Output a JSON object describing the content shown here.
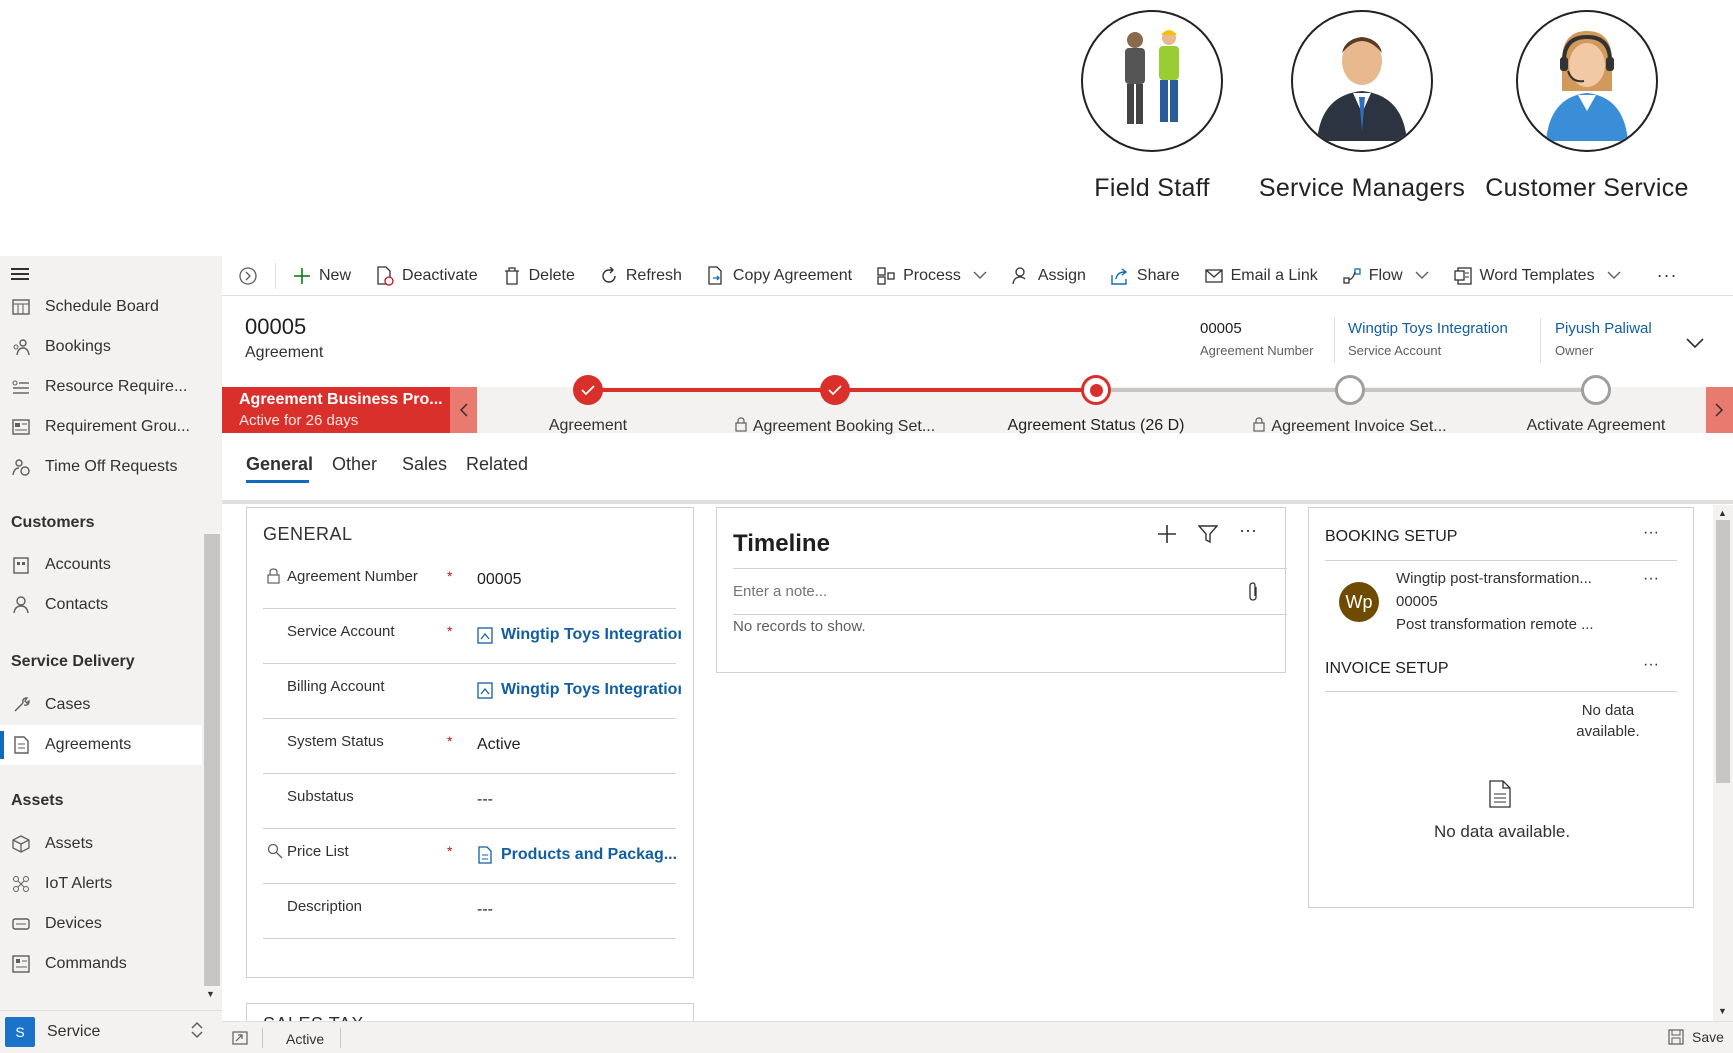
{
  "personas": [
    {
      "label": "Field Staff"
    },
    {
      "label": "Service Managers"
    },
    {
      "label": "Customer Service"
    }
  ],
  "sidebar": {
    "items_top": [
      {
        "label": "Schedule Board",
        "icon": "calendar-grid-icon"
      },
      {
        "label": "Bookings",
        "icon": "people-icon"
      },
      {
        "label": "Resource Require...",
        "icon": "list-icon"
      },
      {
        "label": "Requirement Grou...",
        "icon": "group-list-icon"
      },
      {
        "label": "Time Off Requests",
        "icon": "person-clock-icon"
      }
    ],
    "groups": [
      {
        "title": "Customers",
        "items": [
          {
            "label": "Accounts"
          },
          {
            "label": "Contacts"
          }
        ]
      },
      {
        "title": "Service Delivery",
        "items": [
          {
            "label": "Cases"
          },
          {
            "label": "Agreements"
          }
        ]
      },
      {
        "title": "Assets",
        "items": [
          {
            "label": "Assets"
          },
          {
            "label": "IoT Alerts"
          },
          {
            "label": "Devices"
          },
          {
            "label": "Commands"
          }
        ]
      }
    ],
    "area": {
      "badge": "S",
      "label": "Service"
    }
  },
  "commands": {
    "new": "New",
    "deactivate": "Deactivate",
    "delete": "Delete",
    "refresh": "Refresh",
    "copy": "Copy Agreement",
    "process": "Process",
    "assign": "Assign",
    "share": "Share",
    "email": "Email a Link",
    "flow": "Flow",
    "word": "Word Templates",
    "more": "···"
  },
  "header": {
    "title": "00005",
    "entity": "Agreement",
    "fields": [
      {
        "value": "00005",
        "label": "Agreement Number"
      },
      {
        "value": "Wingtip Toys Integration",
        "label": "Service Account"
      },
      {
        "value": "Piyush Paliwal",
        "label": "Owner"
      }
    ]
  },
  "bpf": {
    "active_title": "Agreement Business Pro...",
    "active_sub": "Active for 26 days",
    "stages": [
      {
        "label": "Agreement",
        "state": "done"
      },
      {
        "label": "Agreement Booking Set...",
        "state": "done"
      },
      {
        "label": "Agreement Status  (26 D)",
        "state": "active"
      },
      {
        "label": "Agreement Invoice Set...",
        "state": "pending"
      },
      {
        "label": "Activate Agreement",
        "state": "pending"
      }
    ]
  },
  "tabs": [
    "General",
    "Other",
    "Sales",
    "Related"
  ],
  "general": {
    "heading": "GENERAL",
    "fields": [
      {
        "label": "Agreement Number",
        "value": "00005"
      },
      {
        "label": "Service Account",
        "value": "Wingtip Toys Integration"
      },
      {
        "label": "Billing Account",
        "value": "Wingtip Toys Integration"
      },
      {
        "label": "System Status",
        "value": "Active"
      },
      {
        "label": "Substatus",
        "value": "---"
      },
      {
        "label": "Price List",
        "value": "Products and Packag..."
      },
      {
        "label": "Description",
        "value": "---"
      }
    ],
    "required_mark": "*"
  },
  "next_section": "SALES TAX",
  "timeline": {
    "title": "Timeline",
    "placeholder": "Enter a note...",
    "empty": "No records to show.",
    "more": "···"
  },
  "booking": {
    "title": "BOOKING SETUP",
    "more": "···",
    "item": {
      "avatar": "Wp",
      "line1": "Wingtip post-transformation...",
      "line2": "00005",
      "line3": "Post transformation remote ..."
    },
    "invoice_title": "INVOICE SETUP",
    "invoice_nodata": "No data available.",
    "nodata": "No data available."
  },
  "statusbar": {
    "status": "Active",
    "save": "Save"
  },
  "colors": {
    "accent": "#0f6cbd",
    "bpf_red": "#d9302b",
    "link": "#115ea3",
    "required": "#c50f1f"
  }
}
